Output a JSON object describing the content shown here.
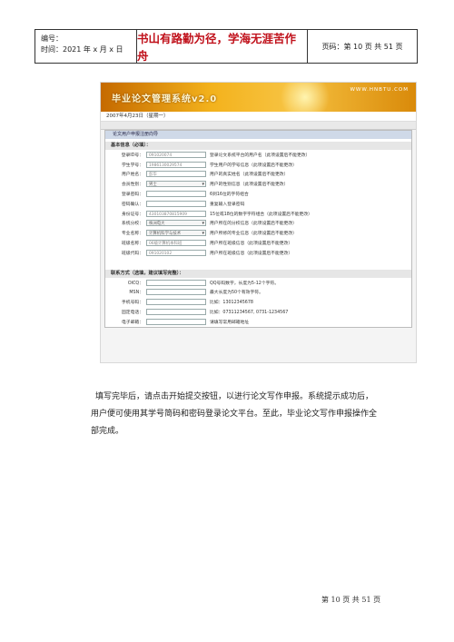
{
  "header": {
    "number_label": "编号：",
    "time_label": "时间：2021 年 x 月 x 日",
    "motto": "书山有路勤为径，学海无涯苦作舟",
    "page_info": "页码：第 10 页 共 51 页"
  },
  "screenshot": {
    "banner_title": "毕业论文管理系统v2.0",
    "banner_url": "WWW.HNBTU.COM",
    "date": "2007年4月23日（星期一）",
    "tab_label": "论文用户申报注册向导",
    "basic_section": "基本信息（必填）：",
    "basic_rows": [
      {
        "label": "登录ID号：",
        "kind": "input",
        "value": "091020074",
        "note": "登录论文系统平台的用户名（此项设置后不能更改）"
      },
      {
        "label": "学生学号：",
        "kind": "input",
        "value": "1986130029574",
        "note": "学生用户的学号信息（此项设置后不能更改）"
      },
      {
        "label": "用户姓名：",
        "kind": "input",
        "value": "彭华",
        "note": "用户的真实姓名（此项设置后不能更改）"
      },
      {
        "label": "会员性别：",
        "kind": "select",
        "value": "男士",
        "note": "用户的性别信息（此项设置后不能更改）"
      },
      {
        "label": "登录密码：",
        "kind": "input",
        "value": "",
        "note": "6到16位的字符组合"
      },
      {
        "label": "密码确认：",
        "kind": "input",
        "value": "",
        "note": "重复输入登录密码"
      },
      {
        "label": "身份证号：",
        "kind": "input",
        "value": "430103870815909",
        "note": "15位或18位的数字字符组合（此项设置后不能更改）"
      },
      {
        "label": "系统分校：",
        "kind": "select",
        "value": "株洲电大",
        "note": "用户所在的分校信息（此项设置后不能更改）"
      },
      {
        "label": "专业名称：",
        "kind": "select",
        "value": "计算机科学与技术",
        "note": "用户所修的专业信息（此项设置后不能更改）"
      },
      {
        "label": "班级名称：",
        "kind": "input",
        "value": "06级计算机本科班",
        "note": "用户所在班级信息（此项设置后不能更改）"
      },
      {
        "label": "班级代码：",
        "kind": "input",
        "value": "091020102",
        "note": "用户所在班级信息（此项设置后不能更改）"
      }
    ],
    "contact_section": "联系方式（选填，建议填写完整）：",
    "contact_rows": [
      {
        "label": "OICQ：",
        "value": "",
        "note": "QQ号码数字，长度为5-12个字符。"
      },
      {
        "label": "MSN：",
        "value": "",
        "note": "最大长度为50个有效字符。"
      },
      {
        "label": "手机号码：",
        "value": "",
        "note": "比如：13012345678"
      },
      {
        "label": "固定电话：",
        "value": "",
        "note": "比如：07311234567, 0731-1234567"
      },
      {
        "label": "电子邮箱：",
        "value": "",
        "note": "请填写常用邮箱地址"
      }
    ]
  },
  "body": {
    "paragraph_line1": "填写完毕后，请点击开始提交按钮，以进行论文写作申报。系统提示成功后，",
    "paragraph_line2": "用户便可使用其学号简码和密码登录论文平台。至此，毕业论文写作申报操作全",
    "paragraph_line3": "部完成。"
  },
  "footer": {
    "page_text": "第 10 页 共 51 页"
  }
}
